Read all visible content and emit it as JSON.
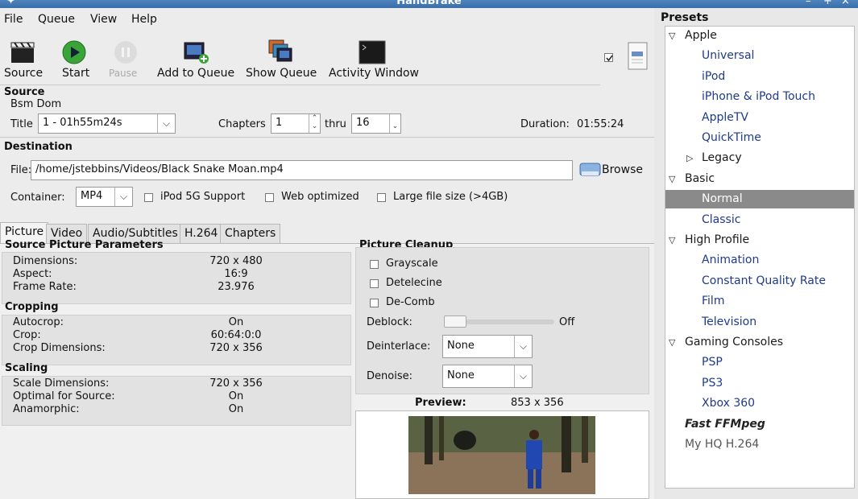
{
  "window": {
    "title": "HandBrake"
  },
  "menu": [
    {
      "label": "File",
      "ul": "F"
    },
    {
      "label": "Queue",
      "ul": "Q"
    },
    {
      "label": "View",
      "ul": "V"
    },
    {
      "label": "Help",
      "ul": "H"
    }
  ],
  "toolbar": {
    "source": "Source",
    "start": "Start",
    "pause": "Pause",
    "add_to_queue": "Add to Queue",
    "show_queue": "Show Queue",
    "activity_window": "Activity Window"
  },
  "source": {
    "header": "Source",
    "name": "Bsm Dom",
    "title_label": "Title",
    "title_value": "1 - 01h55m24s",
    "chapters_label": "Chapters",
    "chapter_from": "1",
    "thru_label": "thru",
    "chapter_to": "16",
    "duration_label": "Duration:",
    "duration_value": "01:55:24"
  },
  "destination": {
    "header": "Destination",
    "file_label": "File:",
    "file_value": "/home/jstebbins/Videos/Black Snake Moan.mp4",
    "browse": "Browse",
    "container_label": "Container:",
    "container_value": "MP4",
    "ipod_5g": "iPod 5G Support",
    "web_optimized": "Web optimized",
    "large_file": "Large file size (>4GB)"
  },
  "tabs": [
    "Picture",
    "Video",
    "Audio/Subtitles",
    "H.264",
    "Chapters"
  ],
  "picture": {
    "source_params": {
      "title": "Source Picture Parameters",
      "rows": [
        {
          "label": "Dimensions:",
          "value": "720 x 480"
        },
        {
          "label": "Aspect:",
          "value": "16:9"
        },
        {
          "label": "Frame Rate:",
          "value": "23.976"
        }
      ]
    },
    "cropping": {
      "title": "Cropping",
      "rows": [
        {
          "label": "Autocrop:",
          "value": "On"
        },
        {
          "label": "Crop:",
          "value": "60:64:0:0"
        },
        {
          "label": "Crop Dimensions:",
          "value": "720 x 356"
        }
      ]
    },
    "scaling": {
      "title": "Scaling",
      "rows": [
        {
          "label": "Scale Dimensions:",
          "value": "720 x 356"
        },
        {
          "label": "Optimal for Source:",
          "value": "On"
        },
        {
          "label": "Anamorphic:",
          "value": "On"
        }
      ]
    },
    "cleanup": {
      "title": "Picture Cleanup",
      "grayscale": "Grayscale",
      "detelecine": "Detelecine",
      "decomb": "De-Comb",
      "deblock_label": "Deblock:",
      "deblock_value": "Off",
      "deinterlace_label": "Deinterlace:",
      "deinterlace_value": "None",
      "denoise_label": "Denoise:",
      "denoise_value": "None"
    },
    "preview": {
      "label": "Preview:",
      "size": "853 x 356"
    }
  },
  "presets": {
    "title": "Presets",
    "items": [
      {
        "text": "Apple",
        "kind": "cat",
        "state": "open"
      },
      {
        "text": "Universal",
        "kind": "child"
      },
      {
        "text": "iPod",
        "kind": "child"
      },
      {
        "text": "iPhone & iPod Touch",
        "kind": "child"
      },
      {
        "text": "AppleTV",
        "kind": "child"
      },
      {
        "text": "QuickTime",
        "kind": "child"
      },
      {
        "text": "Legacy",
        "kind": "subcat",
        "state": "closed"
      },
      {
        "text": "Basic",
        "kind": "cat",
        "state": "open"
      },
      {
        "text": "Normal",
        "kind": "child",
        "selected": true
      },
      {
        "text": "Classic",
        "kind": "child"
      },
      {
        "text": "High Profile",
        "kind": "cat",
        "state": "open"
      },
      {
        "text": "Animation",
        "kind": "child"
      },
      {
        "text": "Constant Quality Rate",
        "kind": "child"
      },
      {
        "text": "Film",
        "kind": "child"
      },
      {
        "text": "Television",
        "kind": "child"
      },
      {
        "text": "Gaming Consoles",
        "kind": "cat",
        "state": "open"
      },
      {
        "text": "PSP",
        "kind": "child"
      },
      {
        "text": "PS3",
        "kind": "child"
      },
      {
        "text": "Xbox 360",
        "kind": "child"
      },
      {
        "text": "Fast FFMpeg",
        "kind": "custom-bold"
      },
      {
        "text": "My HQ H.264",
        "kind": "custom"
      }
    ]
  },
  "colors": {
    "titlebar": "#3a6ea8",
    "preset_link": "#1e3a8a",
    "selected_row": "#8a8a8a"
  }
}
